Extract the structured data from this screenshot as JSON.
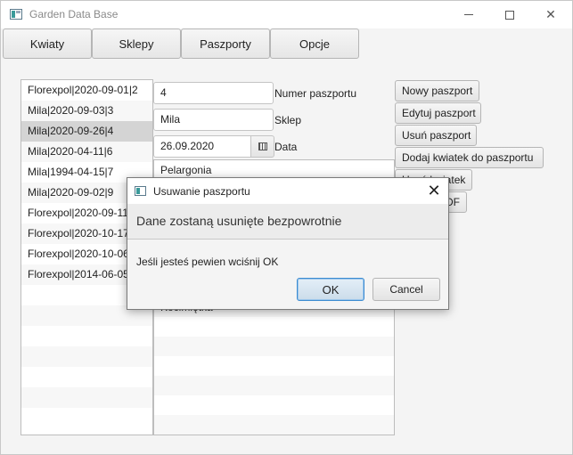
{
  "window": {
    "title": "Garden Data Base",
    "controls": {
      "minimize": "minimize",
      "maximize": "maximize",
      "close": "✕"
    }
  },
  "menu": [
    "Kwiaty",
    "Sklepy",
    "Paszporty",
    "Opcje"
  ],
  "passports": [
    "Florexpol|2020-09-01|2",
    "Mila|2020-09-03|3",
    "Mila|2020-09-26|4",
    "Mila|2020-04-11|6",
    "Mila|1994-04-15|7",
    "Mila|2020-09-02|9",
    "Florexpol|2020-09-11",
    "Florexpol|2020-10-17",
    "Florexpol|2020-10-06",
    "Florexpol|2014-06-05"
  ],
  "selected_passport_index": 2,
  "form": {
    "number_value": "4",
    "number_label": "Numer paszportu",
    "shop_value": "Mila",
    "shop_label": "Sklep",
    "date_value": "26.09.2020",
    "date_label": "Data"
  },
  "flowers": [
    "Pelargonia",
    "",
    "",
    "",
    "",
    "",
    "",
    "Kocimiętka"
  ],
  "actions": {
    "new": "Nowy paszport",
    "edit": "Edytuj paszport",
    "delete": "Usuń paszport",
    "add_flowers": "Dodaj kwiatek do paszportu",
    "remove_flower_partial": "Usuń kwiatek",
    "pdf_partial": "PDF"
  },
  "dialog": {
    "title": "Usuwanie paszportu",
    "header": "Dane zostaną usunięte bezpowrotnie",
    "content": "Jeśli jesteś pewien wciśnij OK",
    "ok": "OK",
    "cancel": "Cancel"
  }
}
